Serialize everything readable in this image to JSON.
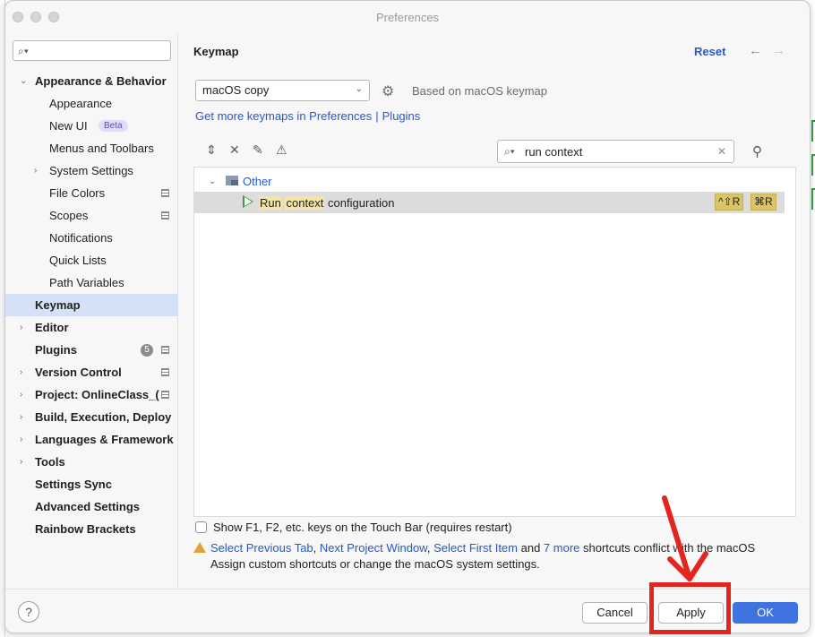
{
  "window": {
    "title": "Preferences"
  },
  "sidebar": {
    "search_placeholder": "",
    "items": [
      {
        "label": "Appearance & Behavior",
        "bold": true,
        "expanded": true
      },
      {
        "label": "Appearance"
      },
      {
        "label": "New UI",
        "badge": "Beta"
      },
      {
        "label": "Menus and Toolbars"
      },
      {
        "label": "System Settings",
        "collapsed": true
      },
      {
        "label": "File Colors"
      },
      {
        "label": "Scopes"
      },
      {
        "label": "Notifications"
      },
      {
        "label": "Quick Lists"
      },
      {
        "label": "Path Variables"
      },
      {
        "label": "Keymap",
        "bold": true,
        "selected": true
      },
      {
        "label": "Editor",
        "bold": true
      },
      {
        "label": "Plugins",
        "bold": true,
        "count": "5"
      },
      {
        "label": "Version Control",
        "bold": true
      },
      {
        "label": "Project: OnlineClass_(",
        "bold": true
      },
      {
        "label": "Build, Execution, Deploy",
        "bold": true
      },
      {
        "label": "Languages & Framework",
        "bold": true
      },
      {
        "label": "Tools",
        "bold": true
      },
      {
        "label": "Settings Sync",
        "bold": true
      },
      {
        "label": "Advanced Settings",
        "bold": true
      },
      {
        "label": "Rainbow Brackets",
        "bold": true
      }
    ]
  },
  "main": {
    "heading": "Keymap",
    "reset_label": "Reset",
    "keymap_select": "macOS copy",
    "based_on": "Based on macOS keymap",
    "links": {
      "get_more": "Get more keymaps in Preferences",
      "separator": "|",
      "plugins": "Plugins"
    },
    "filter": {
      "value": "run context"
    },
    "tree": {
      "group": "Other",
      "action": {
        "part1": "Run",
        "part2": "context",
        "part3": "configuration"
      },
      "shortcuts": [
        "^⇧R",
        "⌘R"
      ]
    },
    "touchbar_label": "Show F1, F2, etc. keys on the Touch Bar (requires restart)",
    "conflict": {
      "links": [
        "Select Previous Tab",
        "Next Project Window",
        "Select First Item"
      ],
      "sep1": ", ",
      "and_text": " and ",
      "more": "7 more",
      "tail": " shortcuts conflict with the macOS",
      "line2": "Assign custom shortcuts or change the macOS system settings."
    }
  },
  "footer": {
    "help": "?",
    "cancel": "Cancel",
    "apply": "Apply",
    "ok": "OK"
  },
  "colors": {
    "accent": "#3f73e0",
    "link": "#2859c5",
    "selection": "#d5e1f6",
    "annotation": "#e2261f",
    "highlight": "#f5e6a6"
  }
}
